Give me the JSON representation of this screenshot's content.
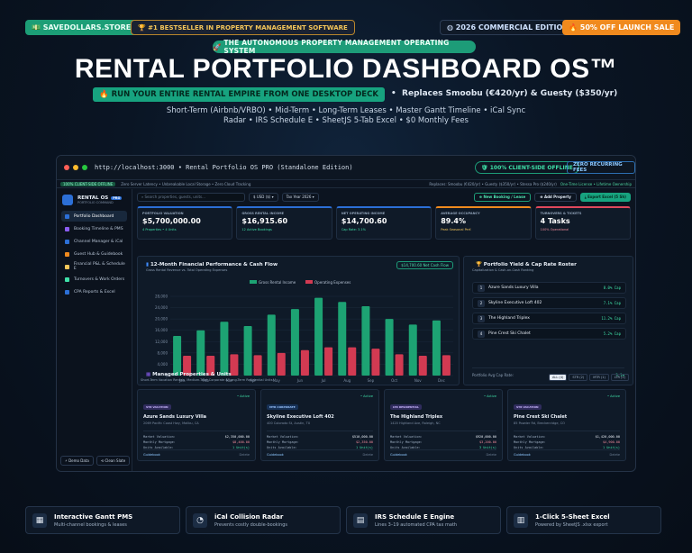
{
  "top": {
    "site": "SAVEDOLLARS.STORE",
    "bestseller": "#1 BESTSELLER IN PROPERTY MANAGEMENT SOFTWARE",
    "edition": "2026 COMMERCIAL EDITION",
    "offer": "50% OFF LAUNCH SALE"
  },
  "hero": {
    "tagline": "THE AUTONOMOUS PROPERTY MANAGEMENT OPERATING SYSTEM",
    "headline": "RENTAL PORTFOLIO DASHBOARD OS™",
    "run": "RUN YOUR ENTIRE RENTAL EMPIRE FROM ONE DESKTOP DECK",
    "replaces": "Replaces Smoobu (€420/yr) & Guesty ($350/yr)",
    "features1": "Short-Term (Airbnb/VRBO) • Mid-Term • Long-Term Leases • Master Gantt Timeline • iCal Sync",
    "features2": "Radar • IRS Schedule E • SheetJS 5-Tab Excel • $0 Monthly Fees"
  },
  "window": {
    "url": "http://localhost:3000 • Rental Portfolio OS PRO (Standalone Edition)",
    "offline": "100% CLIENT-SIDE OFFLINE",
    "zero": "ZERO RECURRING FEES",
    "info_pill": "100% CLIENT-SIDE OFFLINE",
    "info_left": "Zero Server Latency • Unbreakable Local Storage • Zero Cloud Tracking",
    "info_right": "Replaces: Smoobu (€420/yr) • Guesty ($350/yr) • Stessa Pro ($240/yr)",
    "info_hl": "One-Time License • Lifetime Ownership"
  },
  "sidebar": {
    "title": "RENTAL OS",
    "pro": "PRO",
    "subtitle": "PORTFOLIO COMMAND",
    "items": [
      {
        "label": "Portfolio Dashboard",
        "color": "#2c6fd6"
      },
      {
        "label": "Booking Timeline & PMS",
        "color": "#8a5cf0"
      },
      {
        "label": "Channel Manager & iCal",
        "color": "#2c6fd6"
      },
      {
        "label": "Guest Hub & Guidebook",
        "color": "#f08a1e"
      },
      {
        "label": "Financial P&L & Schedule E",
        "color": "#f4c65a"
      },
      {
        "label": "Turnovers & Work Orders",
        "color": "#3fe0a8"
      },
      {
        "label": "CPA Reports & Excel",
        "color": "#2c6fd6"
      }
    ],
    "demo": "Demo Data",
    "clean": "Clean Slate"
  },
  "toolbar": {
    "search_placeholder": "Search properties, guests, units...",
    "currency": "$ USD ($)",
    "year": "Tax Year 2026",
    "new_booking": "New Booking / Lease",
    "add_property": "Add Property",
    "export": "Export Excel (5 Sh)"
  },
  "kpis": [
    {
      "label": "PORTFOLIO VALUATION",
      "value": "$5,700,000.00",
      "sub": "4 Properties • 4 Units",
      "color": "#2c6fd6",
      "subcolor": "#3fe0a8"
    },
    {
      "label": "GROSS RENTAL INCOME",
      "value": "$16,915.60",
      "sub": "12 Active Bookings",
      "color": "#2c6fd6",
      "subcolor": "#3fe0a8"
    },
    {
      "label": "NET OPERATING INCOME",
      "value": "$14,700.60",
      "sub": "Cap Rate: 3.1%",
      "color": "#2c6fd6",
      "subcolor": "#3fe0a8"
    },
    {
      "label": "AVERAGE OCCUPANCY",
      "value": "89.4%",
      "sub": "Peak Seasonal Perf.",
      "color": "#f08a1e",
      "subcolor": "#f4c65a"
    },
    {
      "label": "TURNOVERS & TICKETS",
      "value": "4 Tasks",
      "sub": "100% Operational",
      "color": "#e0485c",
      "subcolor": "#f08a9a"
    }
  ],
  "chart": {
    "title": "12-Month Financial Performance & Cash Flow",
    "subtitle": "Gross Rental Revenue vs. Total Operating Expenses",
    "net_badge": "$14,700.60 Net Cash Flow",
    "legend": {
      "income": "Gross Rental Income",
      "expenses": "Operating Expenses"
    }
  },
  "chart_data": {
    "type": "bar",
    "categories": [
      "Jan",
      "Feb",
      "Mar",
      "Apr",
      "May",
      "Jun",
      "Jul",
      "Aug",
      "Sep",
      "Oct",
      "Nov",
      "Dec"
    ],
    "series": [
      {
        "name": "Gross Rental Income",
        "values": [
          14000,
          16000,
          19000,
          17500,
          21500,
          23500,
          27500,
          26000,
          24500,
          20000,
          18000,
          19500
        ],
        "color": "#1da373"
      },
      {
        "name": "Operating Expenses",
        "values": [
          7000,
          7000,
          7500,
          7200,
          8000,
          9000,
          10000,
          10000,
          9500,
          7500,
          7000,
          7200
        ],
        "color": "#d23a52"
      }
    ],
    "yticks": [
      "28,000",
      "24,000",
      "20,000",
      "16,000",
      "12,000",
      "8,000",
      "4,000",
      "0"
    ],
    "ylim": [
      0,
      28000
    ]
  },
  "yield": {
    "title": "Portfolio Yield & Cap Rate Roster",
    "subtitle": "Capitalization & Cash-on-Cash Ranking",
    "rows": [
      {
        "n": "1",
        "name": "Azure Sands Luxury Villa",
        "cap": "8.0% Cap"
      },
      {
        "n": "2",
        "name": "Skyline Executive Loft 402",
        "cap": "7.1% Cap"
      },
      {
        "n": "3",
        "name": "The Highland Triplex",
        "cap": "11.2% Cap"
      },
      {
        "n": "4",
        "name": "Pine Crest Ski Chalet",
        "cap": "5.2% Cap"
      }
    ],
    "foot_label": "Portfolio Avg Cap Rate:",
    "foot_value": "3.1%"
  },
  "managed": {
    "title": "Managed Properties & Units",
    "subtitle": "Short-Term Vacation Rentals, Medium-Term Corporate & Long-Term Residential Units",
    "tabs": [
      "ALL (4)",
      "STR (2)",
      "MTR (1)",
      "LTR (1)"
    ]
  },
  "properties": [
    {
      "tag": "STR VACATION",
      "tagcolor": "#8a5cf0",
      "status": "• Active",
      "name": "Azure Sands Luxury Villa",
      "addr": "2069 Pacific Coast Hwy, Malibu, CA",
      "valuation": "$2,350,000.00",
      "mortgage": "$8,400.00",
      "units": "1 Unit(s)",
      "guidebook": "Guidebook",
      "delete": "Delete"
    },
    {
      "tag": "MTR CORPORATE",
      "tagcolor": "#2c6fd6",
      "status": "• Active",
      "name": "Skyline Executive Loft 402",
      "addr": "400 Colorado St, Austin, TX",
      "valuation": "$510,000.00",
      "mortgage": "$2,350.00",
      "units": "1 Unit(s)",
      "guidebook": "Guidebook",
      "delete": "Delete"
    },
    {
      "tag": "LTR RESIDENTIAL",
      "tagcolor": "#8a5cf0",
      "status": "• Active",
      "name": "The Highland Triplex",
      "addr": "1420 Highland Ave, Raleigh, NC",
      "valuation": "$920,000.00",
      "mortgage": "$3,200.00",
      "units": "3 Unit(s)",
      "guidebook": "Guidebook",
      "delete": "Delete"
    },
    {
      "tag": "STR VACATION",
      "tagcolor": "#8a5cf0",
      "status": "• Active",
      "name": "Pine Crest Ski Chalet",
      "addr": "85 Powder Rd, Breckenridge, CO",
      "valuation": "$1,420,000.00",
      "mortgage": "$4,900.00",
      "units": "1 Unit(s)",
      "guidebook": "Guidebook",
      "delete": "Delete"
    }
  ],
  "prop_labels": {
    "valuation": "Market Valuation:",
    "mortgage": "Monthly Mortgage:",
    "units": "Units Available:"
  },
  "features": [
    {
      "title": "Interactive Gantt PMS",
      "sub": "Multi-channel bookings & leases",
      "icon": "calendar-icon",
      "glyph": "▦"
    },
    {
      "title": "iCal Collision Radar",
      "sub": "Prevents costly double-bookings",
      "icon": "radar-icon",
      "glyph": "◔"
    },
    {
      "title": "IRS Schedule E Engine",
      "sub": "Lines 3–19 automated CPA tax math",
      "icon": "document-icon",
      "glyph": "▤"
    },
    {
      "title": "1-Click 5-Sheet Excel",
      "sub": "Powered by SheetJS .xlsx export",
      "icon": "spreadsheet-icon",
      "glyph": "▥"
    }
  ]
}
